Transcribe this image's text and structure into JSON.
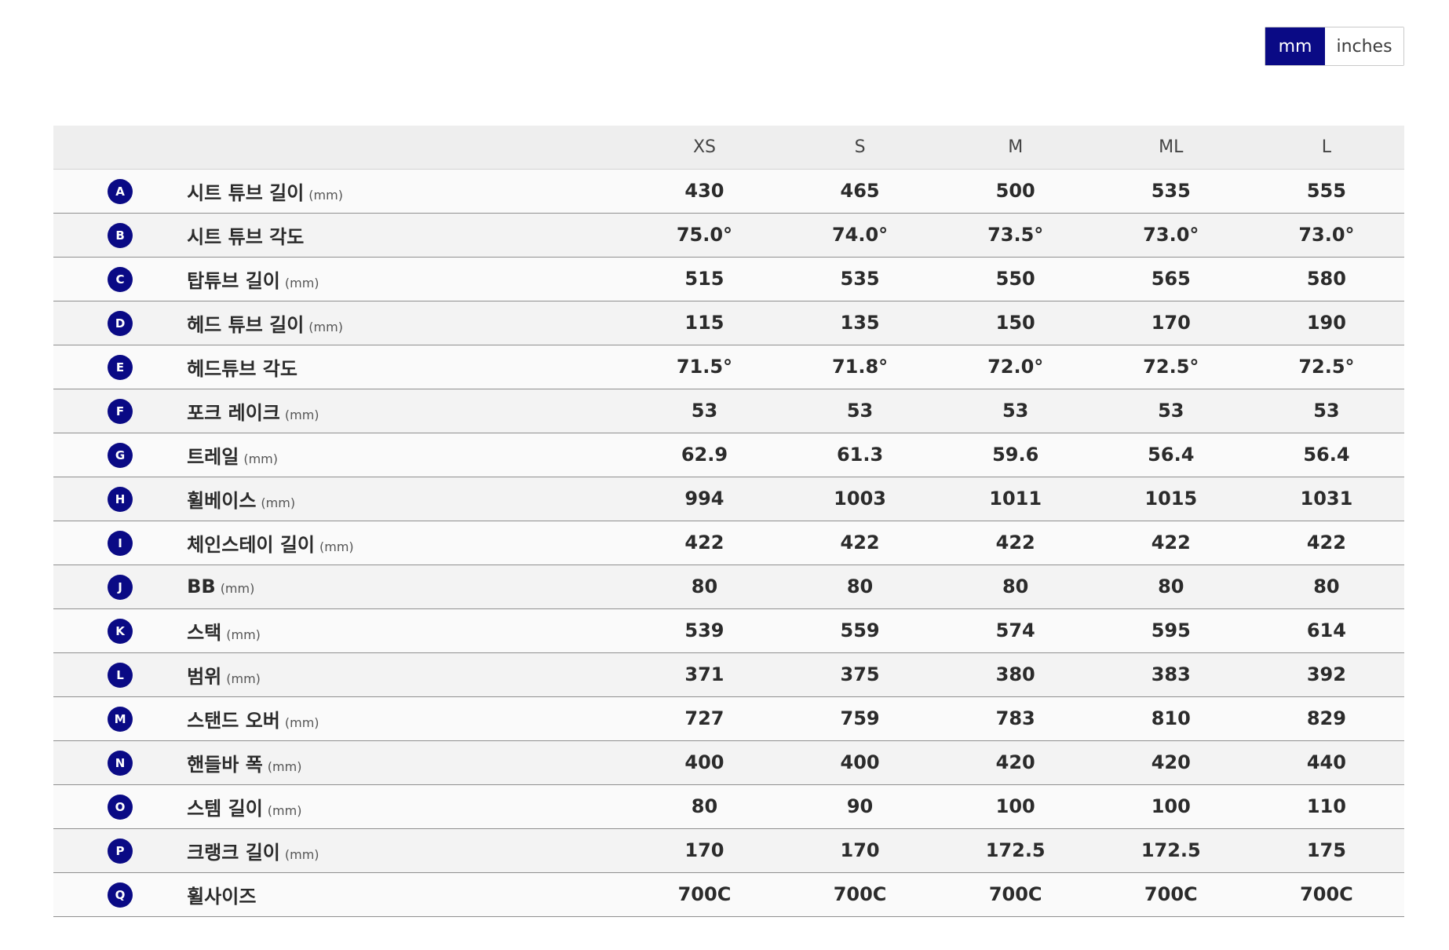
{
  "unit_toggle": {
    "mm_label": "mm",
    "inches_label": "inches",
    "active": "mm"
  },
  "table": {
    "sizes": [
      "XS",
      "S",
      "M",
      "ML",
      "L"
    ],
    "rows": [
      {
        "letter": "A",
        "label": "시트 튜브 길이",
        "unit": "(mm)",
        "values": [
          "430",
          "465",
          "500",
          "535",
          "555"
        ]
      },
      {
        "letter": "B",
        "label": "시트 튜브 각도",
        "unit": "",
        "values": [
          "75.0°",
          "74.0°",
          "73.5°",
          "73.0°",
          "73.0°"
        ]
      },
      {
        "letter": "C",
        "label": "탑튜브 길이",
        "unit": "(mm)",
        "values": [
          "515",
          "535",
          "550",
          "565",
          "580"
        ]
      },
      {
        "letter": "D",
        "label": "헤드 튜브 길이",
        "unit": "(mm)",
        "values": [
          "115",
          "135",
          "150",
          "170",
          "190"
        ]
      },
      {
        "letter": "E",
        "label": "헤드튜브 각도",
        "unit": "",
        "values": [
          "71.5°",
          "71.8°",
          "72.0°",
          "72.5°",
          "72.5°"
        ]
      },
      {
        "letter": "F",
        "label": "포크 레이크",
        "unit": "(mm)",
        "values": [
          "53",
          "53",
          "53",
          "53",
          "53"
        ]
      },
      {
        "letter": "G",
        "label": "트레일",
        "unit": "(mm)",
        "values": [
          "62.9",
          "61.3",
          "59.6",
          "56.4",
          "56.4"
        ]
      },
      {
        "letter": "H",
        "label": "휠베이스",
        "unit": "(mm)",
        "values": [
          "994",
          "1003",
          "1011",
          "1015",
          "1031"
        ]
      },
      {
        "letter": "I",
        "label": "체인스테이 길이",
        "unit": "(mm)",
        "values": [
          "422",
          "422",
          "422",
          "422",
          "422"
        ]
      },
      {
        "letter": "J",
        "label": "BB",
        "unit": "(mm)",
        "values": [
          "80",
          "80",
          "80",
          "80",
          "80"
        ]
      },
      {
        "letter": "K",
        "label": "스택",
        "unit": "(mm)",
        "values": [
          "539",
          "559",
          "574",
          "595",
          "614"
        ]
      },
      {
        "letter": "L",
        "label": "범위",
        "unit": "(mm)",
        "values": [
          "371",
          "375",
          "380",
          "383",
          "392"
        ]
      },
      {
        "letter": "M",
        "label": "스탠드 오버",
        "unit": "(mm)",
        "values": [
          "727",
          "759",
          "783",
          "810",
          "829"
        ]
      },
      {
        "letter": "N",
        "label": "핸들바 폭",
        "unit": "(mm)",
        "values": [
          "400",
          "400",
          "420",
          "420",
          "440"
        ]
      },
      {
        "letter": "O",
        "label": "스템 길이",
        "unit": "(mm)",
        "values": [
          "80",
          "90",
          "100",
          "100",
          "110"
        ]
      },
      {
        "letter": "P",
        "label": "크랭크 길이",
        "unit": "(mm)",
        "values": [
          "170",
          "170",
          "172.5",
          "172.5",
          "175"
        ]
      },
      {
        "letter": "Q",
        "label": "휠사이즈",
        "unit": "",
        "values": [
          "700C",
          "700C",
          "700C",
          "700C",
          "700C"
        ]
      }
    ]
  },
  "colors": {
    "accent": "#0a0a85",
    "header_bg": "#eeeeee",
    "row_odd": "#fafafa",
    "row_even": "#f3f3f3"
  }
}
